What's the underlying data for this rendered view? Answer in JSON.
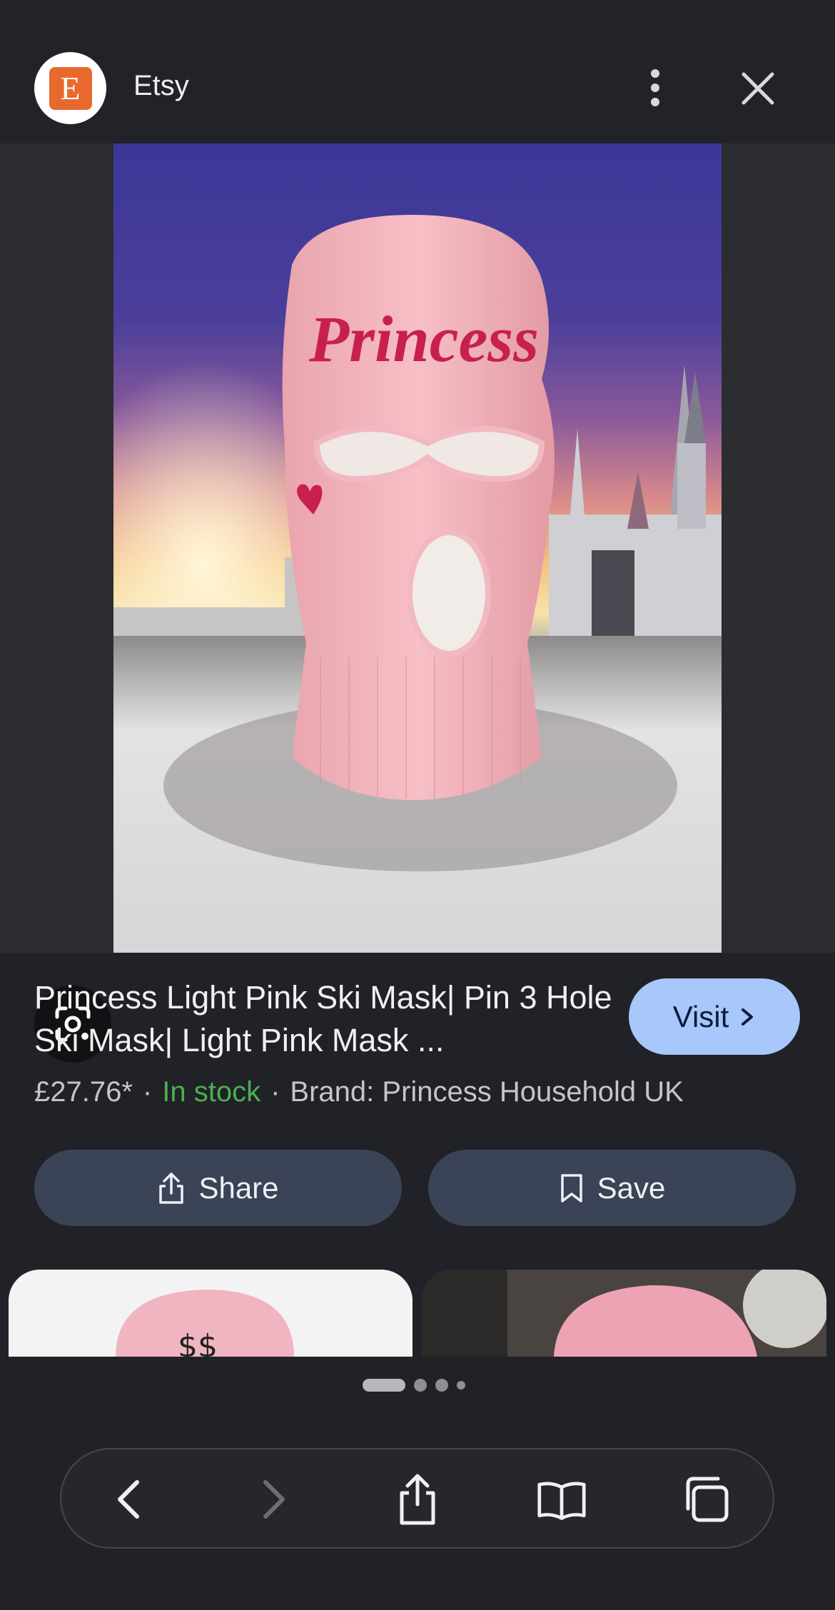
{
  "header": {
    "site_initial": "E",
    "site_name": "Etsy",
    "more_icon": "more-vertical-icon",
    "close_icon": "close-icon"
  },
  "image": {
    "embroidered_text": "Princess"
  },
  "product": {
    "title": "Princess Light Pink Ski Mask| Pin 3 Hole Ski Mask| Light Pink Mask ...",
    "price": "£27.76*",
    "stock": "In stock",
    "brand": "Brand: Princess Household UK",
    "visit_label": "Visit",
    "share_label": "Share",
    "save_label": "Save"
  },
  "colors": {
    "background": "#202227",
    "visit_button": "#a8c7fa",
    "action_button": "#3b4356",
    "stock_green": "#4caf50",
    "etsy_orange": "#e8692d"
  },
  "pager": {
    "pages": 4,
    "current": 1
  },
  "toolbar": {
    "icons": [
      "back-icon",
      "forward-icon",
      "share-icon",
      "bookmarks-icon",
      "tabs-icon"
    ]
  }
}
